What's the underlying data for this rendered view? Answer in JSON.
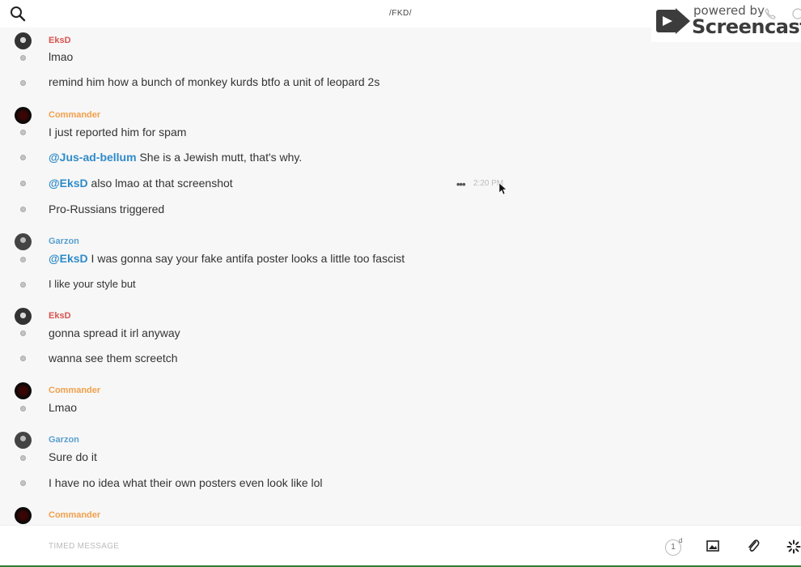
{
  "header": {
    "title": "/FKD/",
    "search_icon": "search-icon"
  },
  "watermark": {
    "line1": "powered by",
    "line2": "Screencastify"
  },
  "messages": [
    {
      "author": "EksD",
      "author_class": "eksd",
      "lines": [
        {
          "segments": [
            {
              "text": "lmao"
            }
          ]
        },
        {
          "segments": [
            {
              "text": "remind him how a bunch of monkey kurds btfo a unit of leopard 2s"
            }
          ]
        }
      ]
    },
    {
      "author": "Commander",
      "author_class": "commander",
      "lines": [
        {
          "segments": [
            {
              "text": "I just reported him for spam"
            }
          ]
        },
        {
          "segments": [
            {
              "mention": "@Jus-ad-bellum"
            },
            {
              "text": " She is a Jewish mutt, that's why."
            }
          ]
        },
        {
          "segments": [
            {
              "mention": "@EksD"
            },
            {
              "text": " also lmao at that screenshot"
            }
          ]
        },
        {
          "segments": [
            {
              "text": "Pro-Russians triggered"
            }
          ]
        }
      ]
    },
    {
      "author": "Garzon",
      "author_class": "garzon",
      "lines": [
        {
          "segments": [
            {
              "mention": "@EksD"
            },
            {
              "text": " I was gonna say your fake antifa poster looks a little too fascist"
            }
          ]
        },
        {
          "segments": [
            {
              "text": "I like your style but"
            }
          ]
        }
      ]
    },
    {
      "author": "EksD",
      "author_class": "eksd",
      "lines": [
        {
          "segments": [
            {
              "text": "gonna spread it irl anyway"
            }
          ]
        },
        {
          "segments": [
            {
              "text": "wanna see them screetch"
            }
          ]
        }
      ]
    },
    {
      "author": "Commander",
      "author_class": "commander",
      "lines": [
        {
          "segments": [
            {
              "text": "Lmao"
            }
          ]
        }
      ]
    },
    {
      "author": "Garzon",
      "author_class": "garzon",
      "lines": [
        {
          "segments": [
            {
              "text": "Sure do it"
            }
          ]
        },
        {
          "segments": [
            {
              "text": "I have no idea what their own posters even look like lol"
            }
          ]
        }
      ]
    },
    {
      "author": "Commander",
      "author_class": "commander",
      "lines": []
    }
  ],
  "hover": {
    "more_label": "•••",
    "timestamp": "2:20 PM"
  },
  "composer": {
    "placeholder": "TIMED MESSAGE",
    "timer_value": "1",
    "timer_unit": "d"
  },
  "colors": {
    "eksd": "#d9534f",
    "commander": "#f0a04b",
    "garzon": "#5aa0d0",
    "mention": "#2e8bc9"
  }
}
